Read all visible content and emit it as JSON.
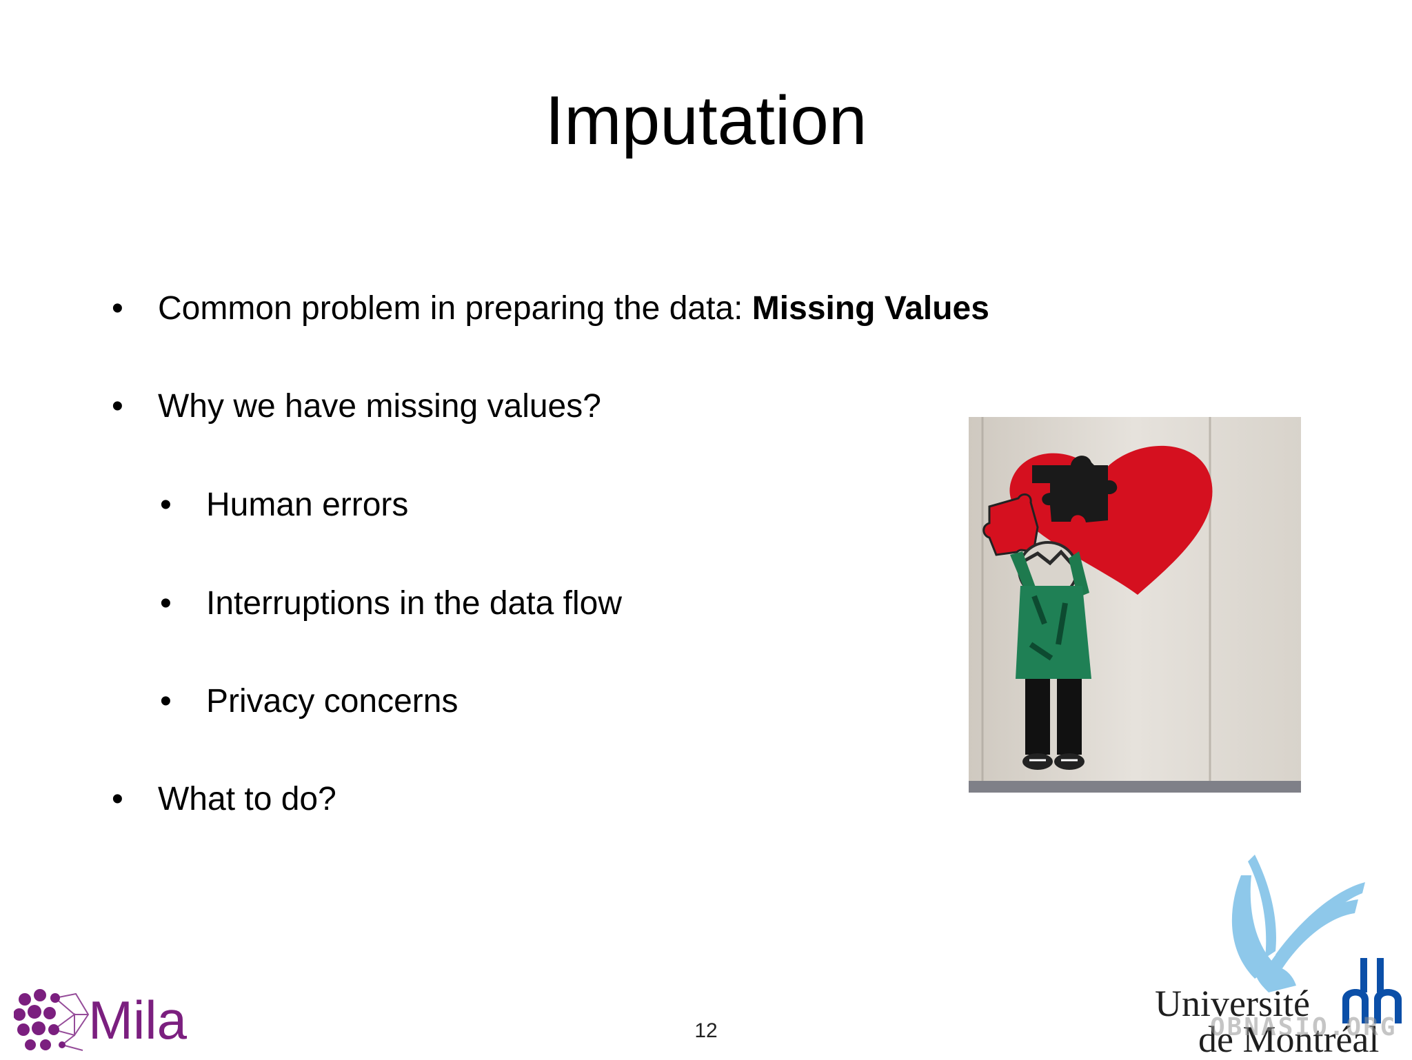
{
  "slide": {
    "title": "Imputation",
    "page_number": "12"
  },
  "bullets": {
    "b1_text": "Common problem in preparing the data: ",
    "b1_bold": "Missing Values",
    "b2": "Why we have missing values?",
    "sub1": "Human errors",
    "sub2": "Interruptions in the data flow",
    "sub3": "Privacy concerns",
    "b3": "What to do?",
    "bullet_glyph": "•"
  },
  "logos": {
    "mila": "Mila",
    "udem_line1": "Université",
    "udem_line2": "de Montréal",
    "watermark": "OBNASIO.ORG"
  },
  "colors": {
    "mila_purple": "#7b1f7f",
    "udem_blue": "#8ec8ea",
    "udem_navy": "#0b4fa8",
    "heart_red": "#d5101f"
  }
}
